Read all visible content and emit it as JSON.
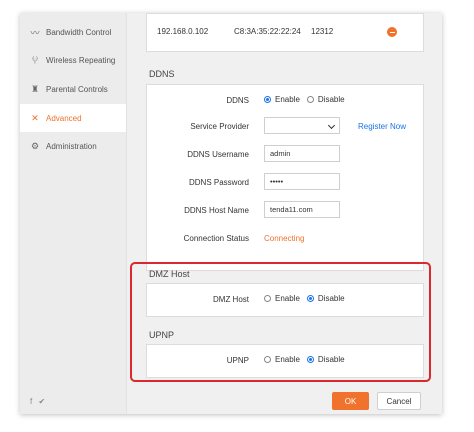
{
  "sidebar": {
    "items": [
      {
        "icon": "bandwidth-icon",
        "label": "Bandwidth Control"
      },
      {
        "icon": "wireless-icon",
        "label": "Wireless Repeating"
      },
      {
        "icon": "parental-icon",
        "label": "Parental Controls"
      },
      {
        "icon": "tools-icon",
        "label": "Advanced"
      },
      {
        "icon": "gear-icon",
        "label": "Administration"
      }
    ],
    "active": "Advanced",
    "footer": "f ✔"
  },
  "device_row": {
    "ip": "192.168.0.102",
    "mac": "C8:3A:35:22:22:24",
    "value": "12312"
  },
  "ddns": {
    "title": "DDNS",
    "ddns_label": "DDNS",
    "enable_label": "Enable",
    "disable_label": "Disable",
    "selected": "Enable",
    "service_provider_label": "Service Provider",
    "service_provider_value": "",
    "register_link": "Register Now",
    "username_label": "DDNS Username",
    "username_value": "admin",
    "password_label": "DDNS Password",
    "password_value": "•••••",
    "hostname_label": "DDNS Host Name",
    "hostname_value": "tenda11.com",
    "connection_status_label": "Connection Status",
    "connection_status_value": "Connecting"
  },
  "dmz": {
    "title": "DMZ Host",
    "label": "DMZ Host",
    "enable_label": "Enable",
    "disable_label": "Disable",
    "selected": "Disable"
  },
  "upnp": {
    "title": "UPNP",
    "label": "UPNP",
    "enable_label": "Enable",
    "disable_label": "Disable",
    "selected": "Disable"
  },
  "buttons": {
    "ok": "OK",
    "cancel": "Cancel"
  },
  "colors": {
    "accent": "#f0722c",
    "link": "#1a73e8",
    "highlight": "#d9292e"
  }
}
